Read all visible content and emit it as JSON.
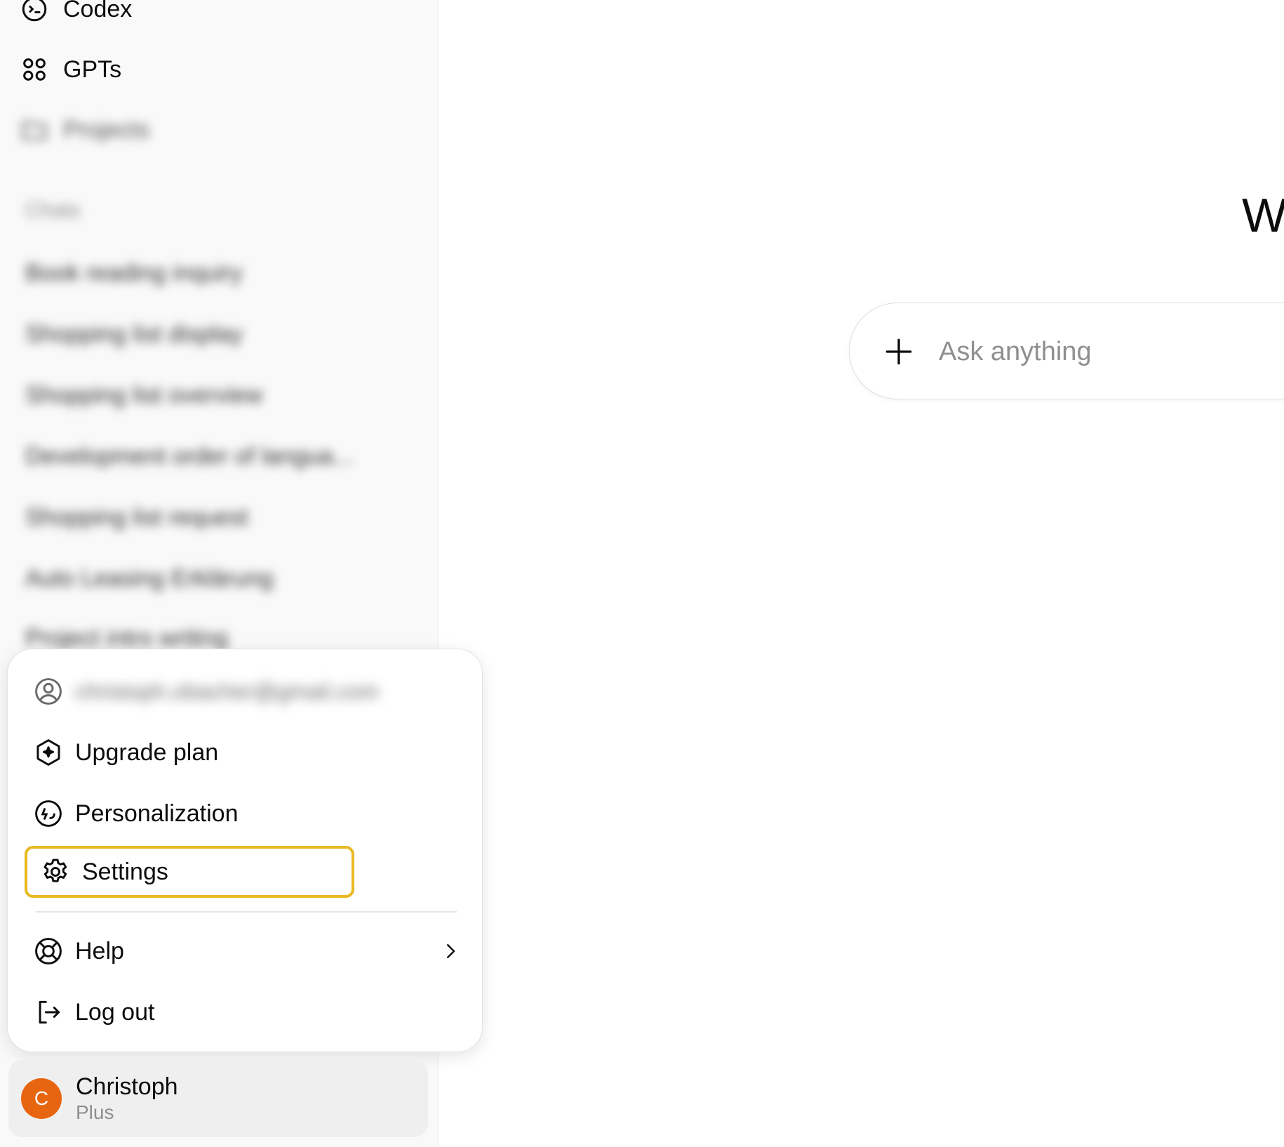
{
  "sidebar": {
    "items": [
      {
        "label": "Codex",
        "icon": "codex-icon"
      },
      {
        "label": "GPTs",
        "icon": "gpts-grid-icon"
      },
      {
        "label": "Projects",
        "icon": "folder-icon"
      }
    ],
    "chats_label": "Chats",
    "chats": [
      "Book reading inquiry",
      "Shopping list display",
      "Shopping list overview",
      "Development order of langua...",
      "Shopping list request",
      "Auto Leasing Erklärung",
      "Project intro writing"
    ]
  },
  "main": {
    "greeting": "W",
    "composer": {
      "placeholder": "Ask anything"
    }
  },
  "menu": {
    "email": "christoph.obacher@gmail.com",
    "items": {
      "upgrade": "Upgrade plan",
      "personalization": "Personalization",
      "settings": "Settings",
      "help": "Help",
      "logout": "Log out"
    }
  },
  "account": {
    "avatar_letter": "C",
    "name": "Christoph",
    "plan": "Plus"
  },
  "colors": {
    "highlight": "#e8b923",
    "avatar": "#e8650f"
  }
}
